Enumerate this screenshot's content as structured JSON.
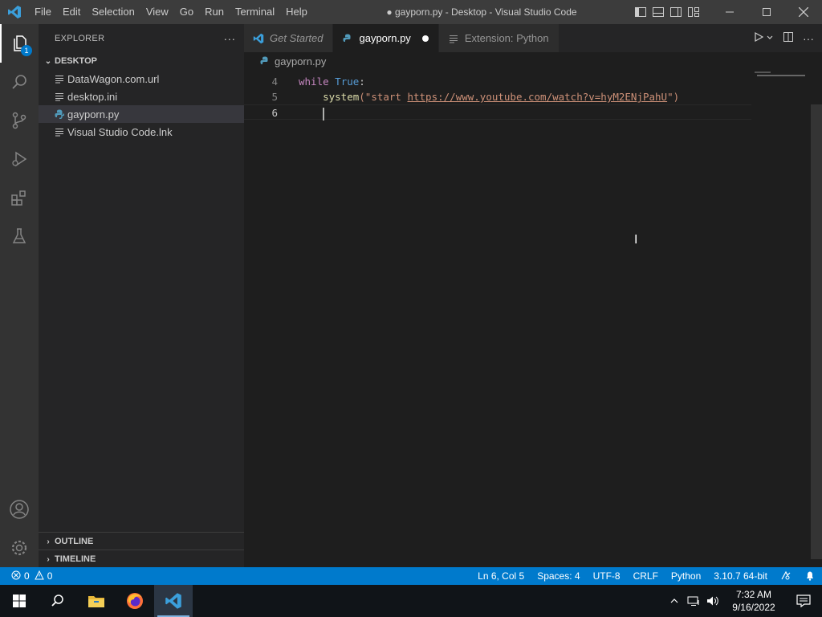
{
  "window": {
    "title": "● gayporn.py - Desktop - Visual Studio Code",
    "menu": [
      "File",
      "Edit",
      "Selection",
      "View",
      "Go",
      "Run",
      "Terminal",
      "Help"
    ]
  },
  "activitybar": {
    "explorer_badge": "1"
  },
  "sidebar": {
    "title": "EXPLORER",
    "more": "···",
    "folder": "DESKTOP",
    "files": [
      {
        "name": "DataWagon.com.url",
        "icon": "file-lines-icon"
      },
      {
        "name": "desktop.ini",
        "icon": "file-lines-icon"
      },
      {
        "name": "gayporn.py",
        "icon": "python-icon"
      },
      {
        "name": "Visual Studio Code.lnk",
        "icon": "file-lines-icon"
      }
    ],
    "outline": "OUTLINE",
    "timeline": "TIMELINE"
  },
  "tabs": [
    {
      "label": "Get Started",
      "icon": "vscode-icon",
      "active": false
    },
    {
      "label": "gayporn.py",
      "icon": "python-icon",
      "active": true,
      "dirty": true
    },
    {
      "label": "Extension: Python",
      "icon": "extension-icon",
      "active": false
    }
  ],
  "breadcrumb": "gayporn.py",
  "code": {
    "lines": [
      {
        "number": "4",
        "keyword": "while",
        "constant": "True",
        "tail": ":"
      },
      {
        "number": "5",
        "fn": "system",
        "open": "(\"start ",
        "url": "https://www.youtube.com/watch?v=hyM2ENjPahU",
        "close": "\")"
      },
      {
        "number": "6"
      }
    ]
  },
  "statusbar": {
    "errors": "0",
    "warnings": "0",
    "position": "Ln 6, Col 5",
    "spaces": "Spaces: 4",
    "encoding": "UTF-8",
    "eol": "CRLF",
    "language": "Python",
    "interpreter": "3.10.7 64-bit"
  },
  "taskbar": {
    "time": "7:32 AM",
    "date": "9/16/2022"
  },
  "colors": {
    "accent": "#007acc",
    "titlebar": "#3c3c3c",
    "sidebar": "#252526",
    "editor": "#1e1e1e"
  }
}
